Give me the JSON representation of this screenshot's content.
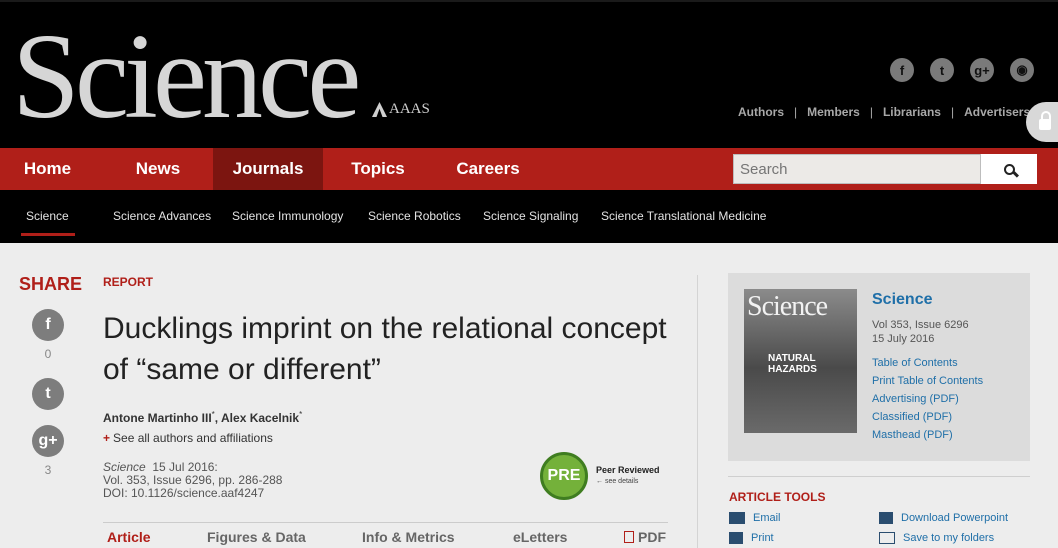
{
  "header": {
    "logo": "Science",
    "publisher": "AAAS",
    "social": [
      {
        "icon": "facebook-icon",
        "glyph": "f"
      },
      {
        "icon": "twitter-icon",
        "glyph": "t"
      },
      {
        "icon": "google-plus-icon",
        "glyph": "g+"
      },
      {
        "icon": "rss-icon",
        "glyph": "◉"
      }
    ],
    "top_links": [
      "Authors",
      "Members",
      "Librarians",
      "Advertisers"
    ]
  },
  "nav": {
    "items": [
      "Home",
      "News",
      "Journals",
      "Topics",
      "Careers"
    ],
    "active": "Journals",
    "search_placeholder": "Search"
  },
  "subnav": {
    "items": [
      "Science",
      "Science Advances",
      "Science Immunology",
      "Science Robotics",
      "Science Signaling",
      "Science Translational Medicine"
    ],
    "active": "Science"
  },
  "share": {
    "title": "SHARE",
    "buttons": [
      {
        "icon": "facebook-icon",
        "glyph": "f",
        "count": "0"
      },
      {
        "icon": "twitter-icon",
        "glyph": "t",
        "count": ""
      },
      {
        "icon": "google-plus-icon",
        "glyph": "g+",
        "count": "3"
      }
    ]
  },
  "article": {
    "type": "REPORT",
    "title": "Ducklings imprint on the relational concept of “same or different”",
    "authors": [
      {
        "name": "Antone Martinho III",
        "mark": "*"
      },
      {
        "name": "Alex Kacelnik",
        "mark": "*"
      }
    ],
    "affiliations_link": "See all authors and affiliations",
    "citation": {
      "journal": "Science",
      "date": "15 Jul 2016:",
      "volume": "Vol. 353, Issue 6296, pp. 286-288",
      "doi": "DOI: 10.1126/science.aaf4247"
    },
    "peer_badge": {
      "logo": "PRE",
      "label": "Peer Reviewed",
      "sub": "← see details"
    },
    "tabs": [
      "Article",
      "Figures & Data",
      "Info & Metrics",
      "eLetters",
      "PDF"
    ],
    "active_tab": "Article"
  },
  "issue": {
    "cover_masthead": "Science",
    "cover_headline": "NATURAL HAZARDS",
    "journal": "Science",
    "volume": "Vol 353, Issue 6296",
    "date": "15 July 2016",
    "links": [
      "Table of Contents",
      "Print Table of Contents",
      "Advertising (PDF)",
      "Classified (PDF)",
      "Masthead (PDF)"
    ]
  },
  "tools": {
    "title": "ARTICLE TOOLS",
    "items": [
      {
        "label": "Email",
        "icon": "email-icon"
      },
      {
        "label": "Download Powerpoint",
        "icon": "download-icon"
      },
      {
        "label": "Print",
        "icon": "print-icon"
      },
      {
        "label": "Save to my folders",
        "icon": "folder-icon"
      }
    ]
  },
  "colors": {
    "brand_red": "#b01f19",
    "link_blue": "#1f6fa8",
    "header_bg": "#000000"
  }
}
